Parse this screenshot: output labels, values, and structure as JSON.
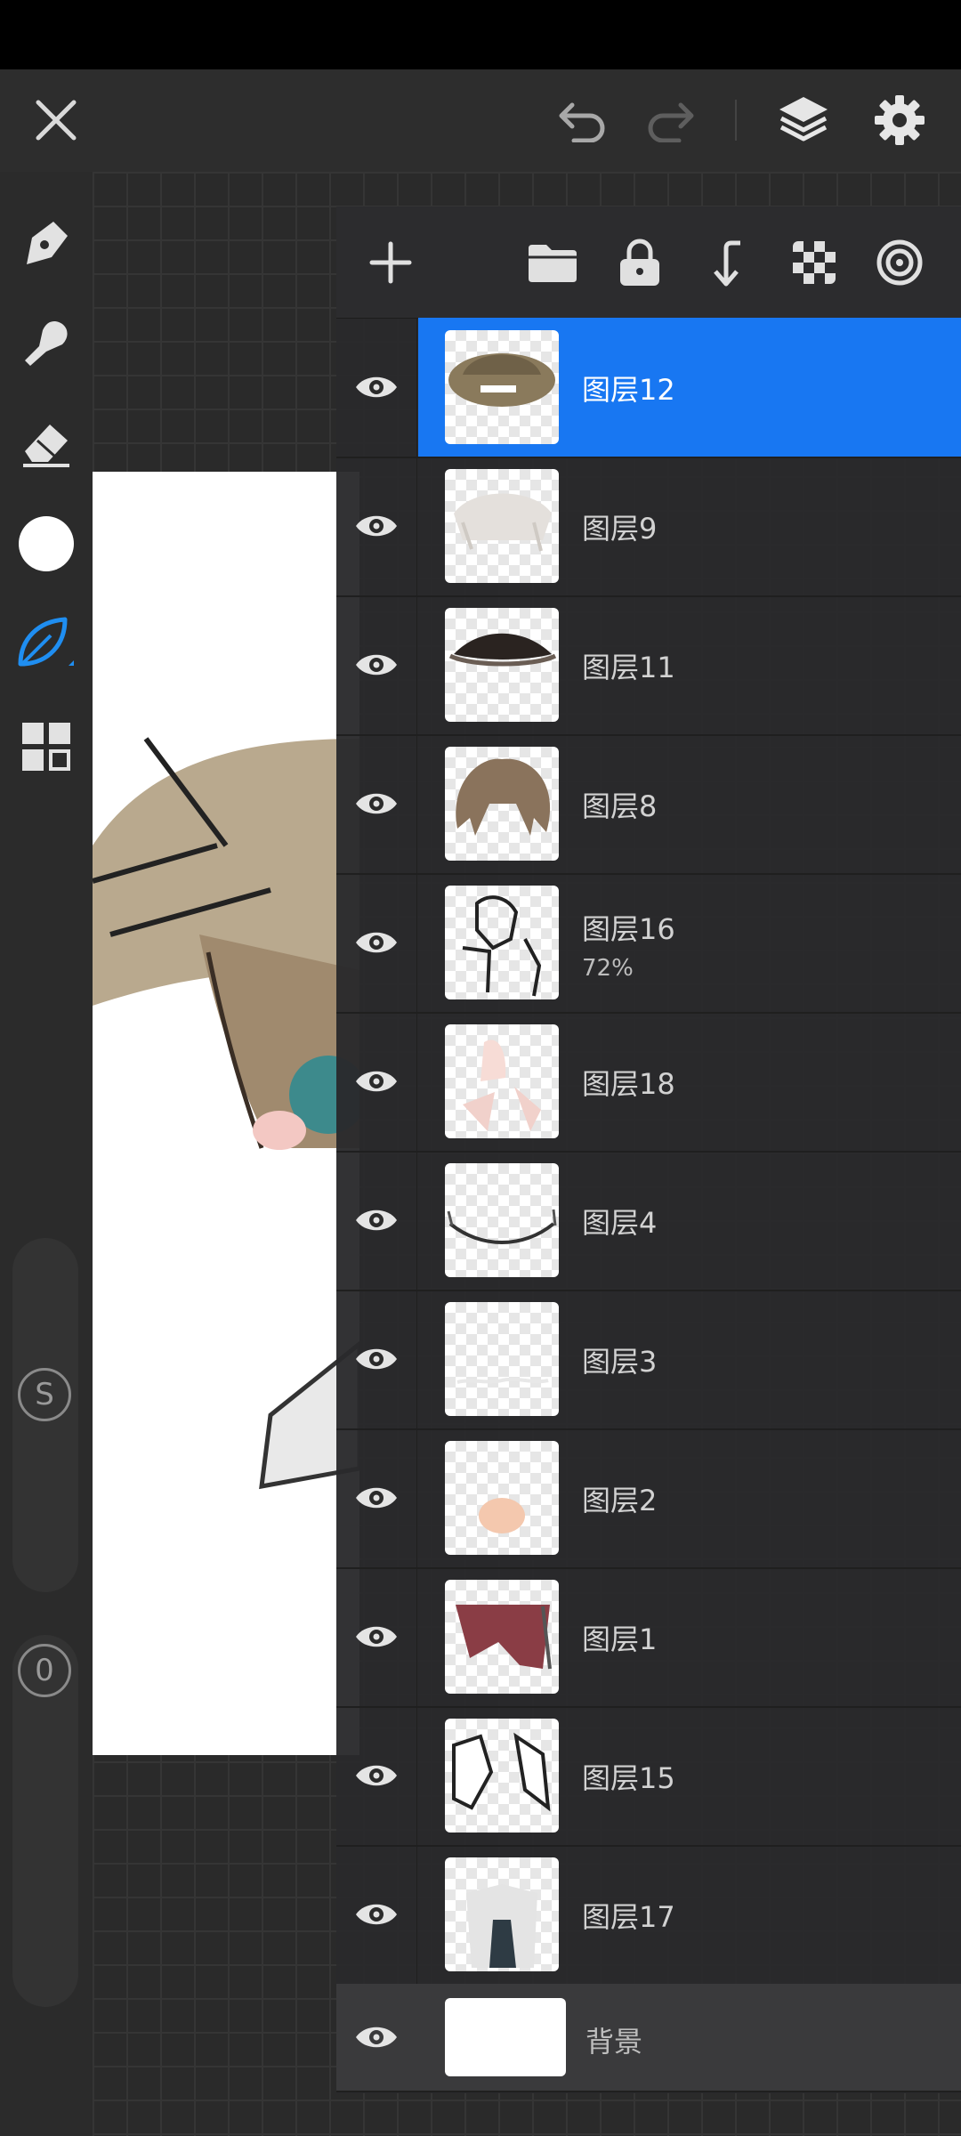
{
  "app": {
    "layers_panel": {
      "layers": [
        {
          "name": "图层12",
          "selected": true,
          "visible": true,
          "thumb": "hat"
        },
        {
          "name": "图层9",
          "visible": true,
          "thumb": "hair-light"
        },
        {
          "name": "图层11",
          "visible": true,
          "thumb": "hair-shadow"
        },
        {
          "name": "图层8",
          "visible": true,
          "thumb": "hair"
        },
        {
          "name": "图层16",
          "opacity": "72%",
          "visible": true,
          "thumb": "hands-lineart"
        },
        {
          "name": "图层18",
          "visible": true,
          "thumb": "hands-skin"
        },
        {
          "name": "图层4",
          "visible": true,
          "thumb": "mouth-line"
        },
        {
          "name": "图层3",
          "visible": true,
          "thumb": "faint"
        },
        {
          "name": "图层2",
          "visible": true,
          "thumb": "blush"
        },
        {
          "name": "图层1",
          "visible": true,
          "thumb": "scarf"
        },
        {
          "name": "图层15",
          "visible": true,
          "thumb": "sleeves-lineart"
        },
        {
          "name": "图层17",
          "visible": true,
          "thumb": "shirt"
        }
      ],
      "background_layer": {
        "name": "背景",
        "visible": true
      }
    },
    "sliders": {
      "size_label": "S",
      "opacity_label": "0"
    },
    "colors": {
      "accent": "#1877f2",
      "current_color": "#ffffff"
    },
    "icons": {
      "close": "close-icon",
      "undo": "undo-icon",
      "redo": "redo-icon",
      "layers": "layers-icon",
      "settings": "gear-icon",
      "add": "plus-icon",
      "folder": "folder-icon",
      "lock": "lock-icon",
      "merge_down": "merge-down-icon",
      "alpha": "checkerboard-icon",
      "blend": "blend-target-icon"
    }
  }
}
